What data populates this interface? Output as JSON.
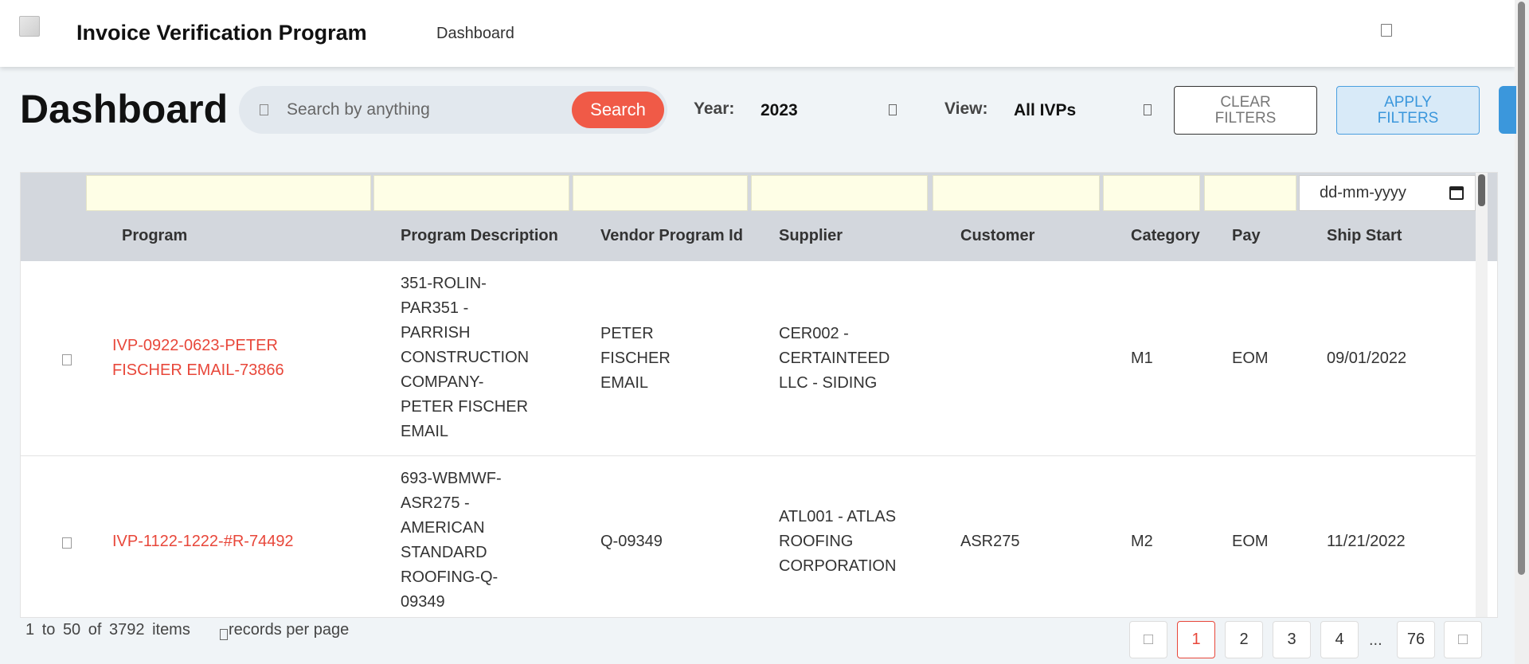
{
  "header": {
    "app_title": "Invoice Verification Program",
    "nav_dashboard": "Dashboard"
  },
  "toolbar": {
    "page_title": "Dashboard",
    "search_placeholder": "Search by anything",
    "search_button": "Search",
    "year_label": "Year:",
    "year_value": "2023",
    "view_label": "View:",
    "view_value": "All IVPs",
    "clear_filters_line1": "CLEAR",
    "clear_filters_line2": "FILTERS",
    "apply_filters_line1": "APPLY",
    "apply_filters_line2": "FILTERS"
  },
  "table": {
    "date_placeholder": "dd-mm-yyyy",
    "columns": [
      "Program",
      "Program Description",
      "Vendor Program Id",
      "Supplier",
      "Customer",
      "Category",
      "Pay",
      "Ship Start"
    ],
    "rows": [
      {
        "program": [
          "IVP-0922-0623-PETER",
          "FISCHER EMAIL-73866"
        ],
        "description": [
          "351-ROLIN-",
          "PAR351 -",
          "PARRISH",
          "CONSTRUCTION",
          "COMPANY-",
          "PETER FISCHER",
          "EMAIL"
        ],
        "vendor_program_id": [
          "PETER",
          "FISCHER",
          "EMAIL"
        ],
        "supplier": [
          "CER002 -",
          "CERTAINTEED",
          "LLC - SIDING"
        ],
        "customer": "",
        "category": "M1",
        "pay": "EOM",
        "ship_start": "09/01/2022"
      },
      {
        "program": [
          "IVP-1122-1222-#R-74492"
        ],
        "description": [
          "693-WBMWF-",
          "ASR275 -",
          "AMERICAN",
          "STANDARD",
          "ROOFING-Q-",
          "09349"
        ],
        "vendor_program_id": [
          "Q-09349"
        ],
        "supplier": [
          "ATL001 - ATLAS",
          "ROOFING",
          "CORPORATION"
        ],
        "customer": "ASR275",
        "category": "M2",
        "pay": "EOM",
        "ship_start": "11/21/2022"
      }
    ]
  },
  "footer": {
    "range_from": "1",
    "to_word": "to",
    "range_to": "50",
    "of_word": "of",
    "total": "3792",
    "items_word": "items",
    "records_per_page": "records per page",
    "pages": [
      "1",
      "2",
      "3",
      "4"
    ],
    "ellipsis": "...",
    "last_page": "76"
  }
}
